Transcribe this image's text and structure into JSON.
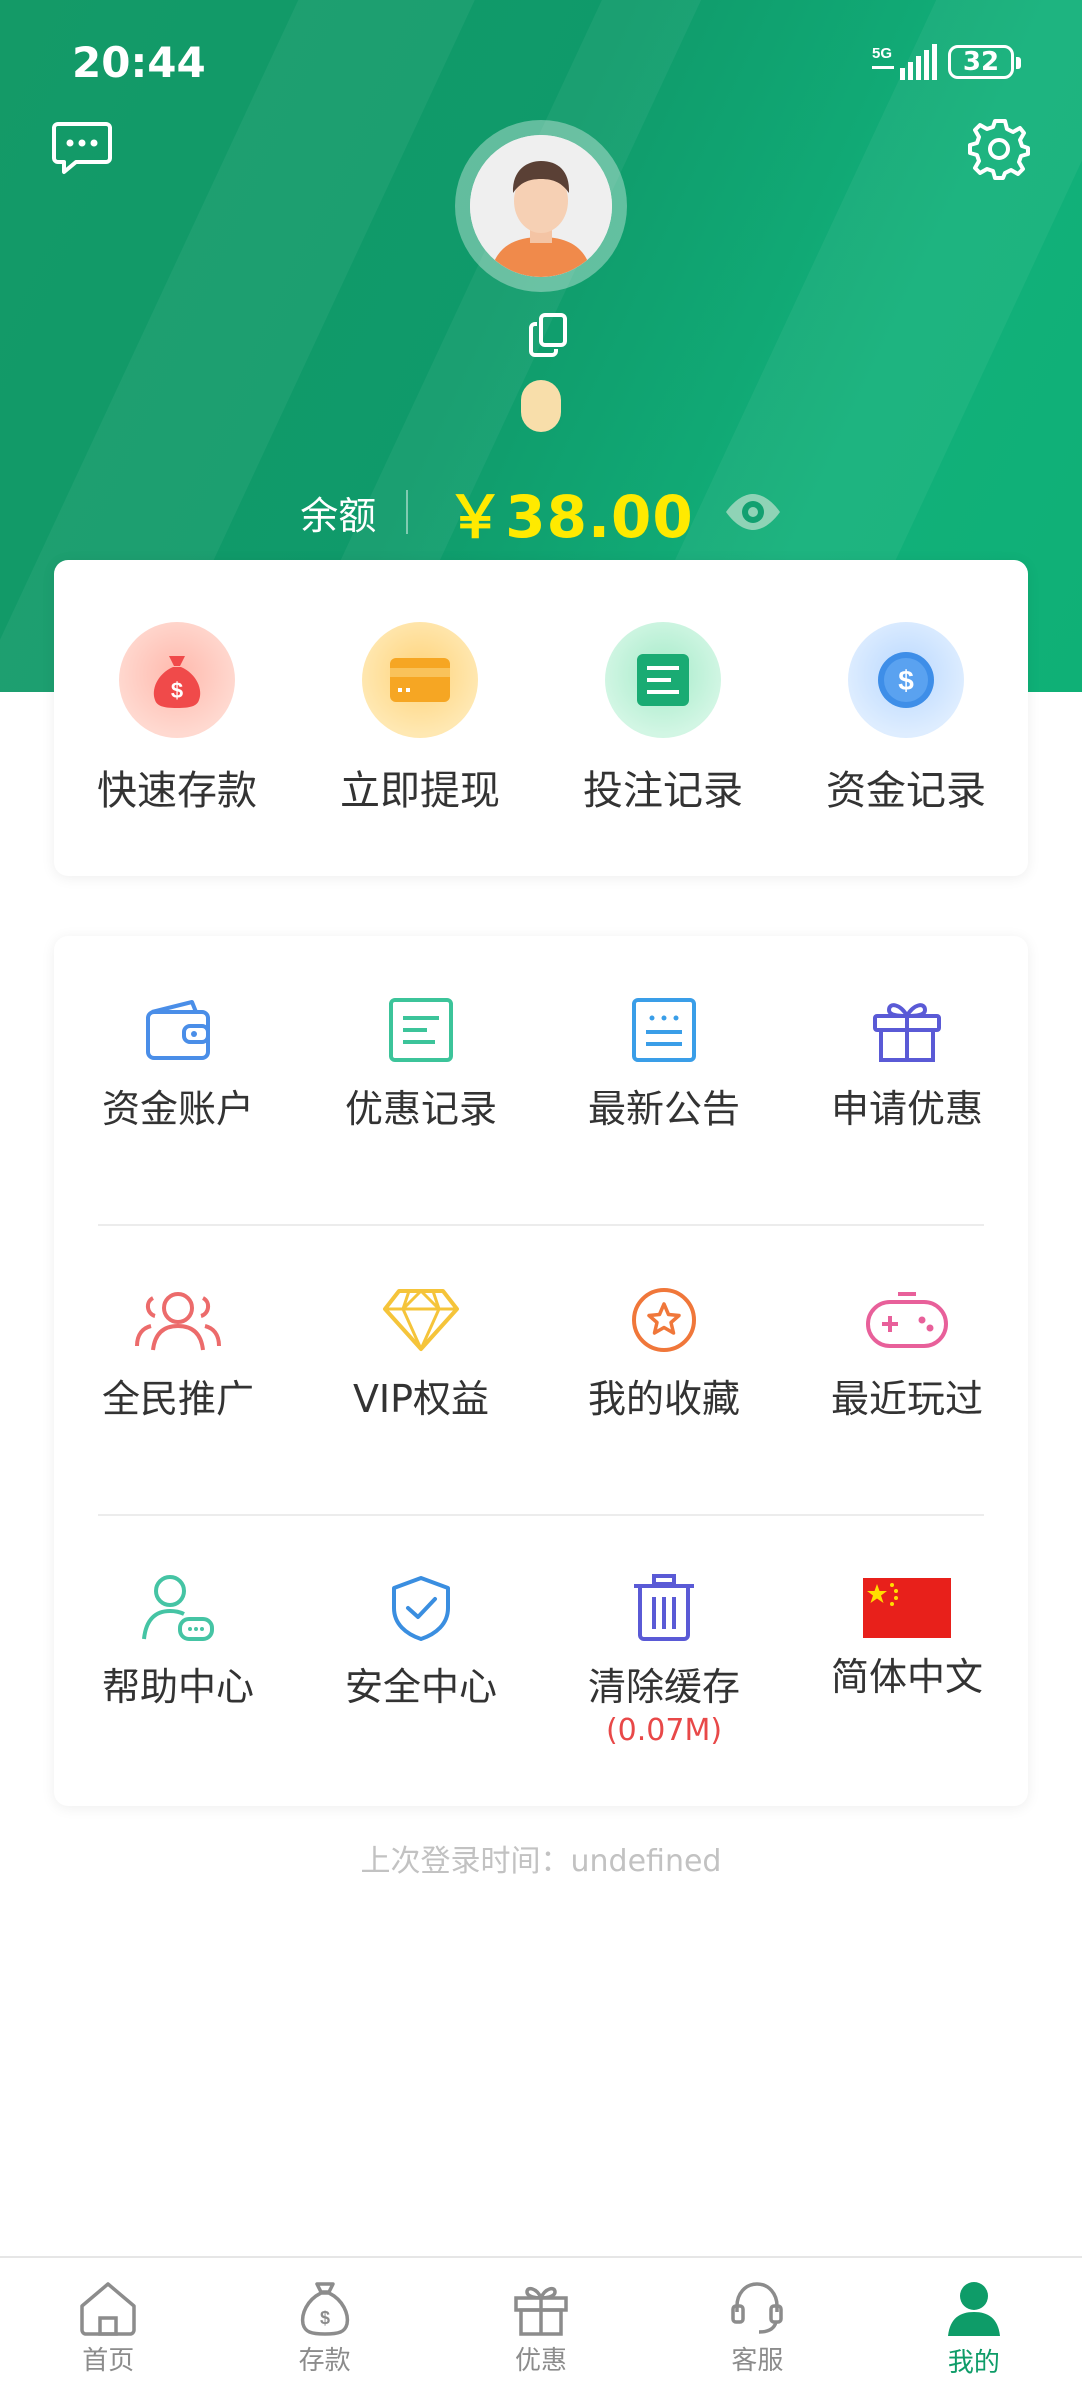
{
  "status_bar": {
    "time": "20:44",
    "network": "5G",
    "battery": "32"
  },
  "header": {
    "balance_label": "余额",
    "balance_amount": "￥38.00"
  },
  "quick_actions": [
    {
      "label": "快速存款",
      "icon": "money-bag-icon"
    },
    {
      "label": "立即提现",
      "icon": "card-icon"
    },
    {
      "label": "投注记录",
      "icon": "document-icon"
    },
    {
      "label": "资金记录",
      "icon": "dollar-coin-icon"
    }
  ],
  "menu": {
    "rows": [
      [
        {
          "label": "资金账户",
          "icon": "wallet-icon"
        },
        {
          "label": "优惠记录",
          "icon": "list-doc-icon"
        },
        {
          "label": "最新公告",
          "icon": "notice-icon"
        },
        {
          "label": "申请优惠",
          "icon": "gift-icon"
        }
      ],
      [
        {
          "label": "全民推广",
          "icon": "users-icon"
        },
        {
          "label": "VIP权益",
          "icon": "diamond-icon"
        },
        {
          "label": "我的收藏",
          "icon": "star-icon"
        },
        {
          "label": "最近玩过",
          "icon": "gamepad-icon"
        }
      ],
      [
        {
          "label": "帮助中心",
          "icon": "help-user-icon"
        },
        {
          "label": "安全中心",
          "icon": "shield-icon"
        },
        {
          "label": "清除缓存",
          "icon": "trash-icon",
          "sub": "(0.07M)"
        },
        {
          "label": "简体中文",
          "icon": "china-flag-icon"
        }
      ]
    ]
  },
  "last_login": "上次登录时间：undefined",
  "tabbar": [
    {
      "label": "首页",
      "icon": "home-icon",
      "active": false
    },
    {
      "label": "存款",
      "icon": "money-bag-icon",
      "active": false
    },
    {
      "label": "优惠",
      "icon": "gift-icon",
      "active": false
    },
    {
      "label": "客服",
      "icon": "headset-icon",
      "active": false
    },
    {
      "label": "我的",
      "icon": "user-icon",
      "active": true
    }
  ],
  "colors": {
    "brand_green": "#0e9c68",
    "balance_yellow": "#ffea00",
    "cache_red": "#e84848"
  }
}
